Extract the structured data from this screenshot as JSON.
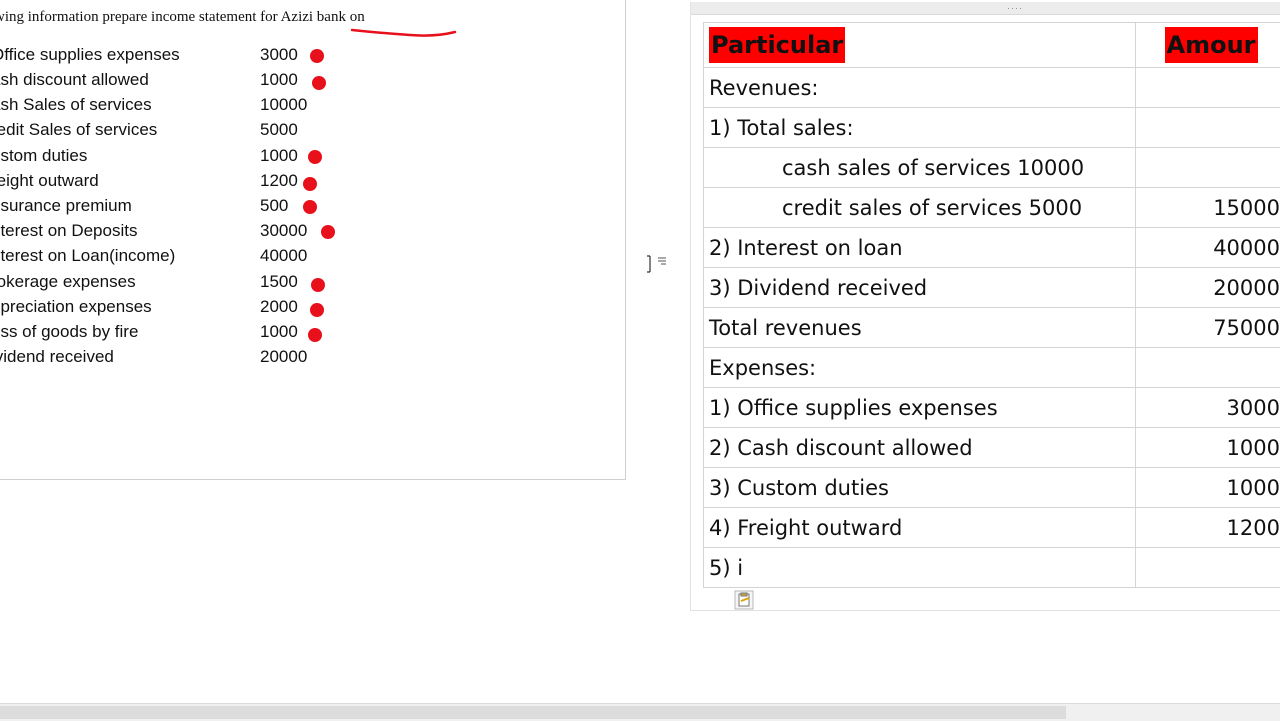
{
  "document": {
    "heading": "wing information prepare income statement for Azizi bank on",
    "items": [
      {
        "label": "Office supplies expenses",
        "amount": "3000",
        "marked": true
      },
      {
        "label": "ash discount allowed",
        "amount": "1000",
        "marked": true
      },
      {
        "label": "ash Sales of services",
        "amount": "10000",
        "marked": false
      },
      {
        "label": "redit Sales of services",
        "amount": "5000",
        "marked": false
      },
      {
        "label": "ustom duties",
        "amount": "1000",
        "marked": true
      },
      {
        "label": "reight outward",
        "amount": "1200",
        "marked": true
      },
      {
        "label": "nsurance premium",
        "amount": "500",
        "marked": true
      },
      {
        "label": "nterest on Deposits",
        "amount": "30000",
        "marked": true
      },
      {
        "label": "nterest on Loan(income)",
        "amount": "40000",
        "marked": false
      },
      {
        "label": "rokerage expenses",
        "amount": "1500",
        "marked": true
      },
      {
        "label": "epreciation expenses",
        "amount": "2000",
        "marked": true
      },
      {
        "label": "oss of goods by fire",
        "amount": "1000",
        "marked": true
      },
      {
        "label": "ividend received",
        "amount": "20000",
        "marked": false
      }
    ]
  },
  "sheet": {
    "headers": {
      "particular": "Particular",
      "amount": "Amour"
    },
    "rows": [
      {
        "label": "Revenues:",
        "amount": "",
        "indent": false
      },
      {
        "label": "1) Total sales:",
        "amount": "",
        "indent": false
      },
      {
        "label": "cash sales of services  10000",
        "amount": "",
        "indent": true
      },
      {
        "label": "credit sales of services 5000",
        "amount": "15000",
        "indent": true
      },
      {
        "label": "2) Interest on loan",
        "amount": "40000",
        "indent": false
      },
      {
        "label": "3) Dividend received",
        "amount": "20000",
        "indent": false
      },
      {
        "label": "Total revenues",
        "amount": "75000",
        "indent": false
      },
      {
        "label": "Expenses:",
        "amount": "",
        "indent": false
      },
      {
        "label": "1) Office supplies expenses",
        "amount": "3000",
        "indent": false
      },
      {
        "label": "2) Cash discount allowed",
        "amount": "1000",
        "indent": false
      },
      {
        "label": "3) Custom duties",
        "amount": "1000",
        "indent": false
      },
      {
        "label": "4) Freight outward",
        "amount": "1200",
        "indent": false
      },
      {
        "label": "5) i",
        "amount": "",
        "indent": false
      }
    ]
  },
  "colors": {
    "header_fill": "#ff0000",
    "marker_dot": "#e8101a",
    "annotation_ink": "#e8101a"
  },
  "icons": {
    "text_cursor": "i-beam-cursor-icon",
    "paste_options": "paste-options-icon",
    "panel_grip": "drag-grip-icon"
  }
}
